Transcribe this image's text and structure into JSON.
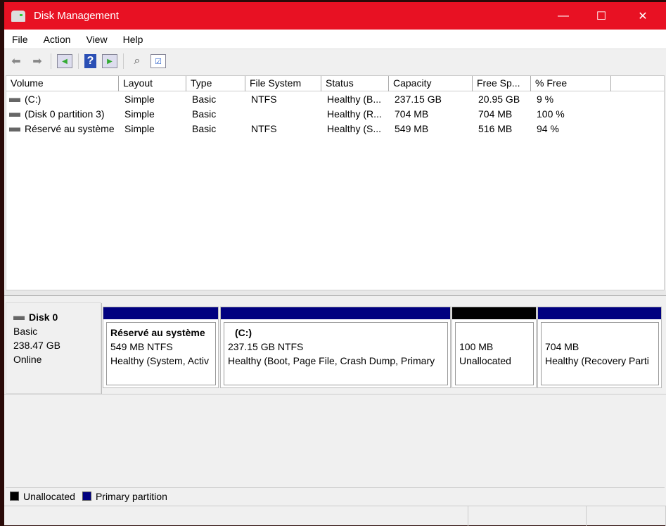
{
  "window": {
    "title": "Disk Management",
    "minimize": "—",
    "maximize": "☐",
    "close": "✕"
  },
  "menu": [
    "File",
    "Action",
    "View",
    "Help"
  ],
  "columns": [
    "Volume",
    "Layout",
    "Type",
    "File System",
    "Status",
    "Capacity",
    "Free Sp...",
    "% Free"
  ],
  "volumes": [
    [
      "(C:)",
      "Simple",
      "Basic",
      "NTFS",
      "Healthy (B...",
      "237.15 GB",
      "20.95 GB",
      "9 %"
    ],
    [
      "(Disk 0 partition 3)",
      "Simple",
      "Basic",
      "",
      "Healthy (R...",
      "704 MB",
      "704 MB",
      "100 %"
    ],
    [
      "Réservé au système",
      "Simple",
      "Basic",
      "NTFS",
      "Healthy (S...",
      "549 MB",
      "516 MB",
      "94 %"
    ]
  ],
  "disk": {
    "name": "Disk 0",
    "type": "Basic",
    "size": "238.47 GB",
    "status": "Online"
  },
  "partitions": [
    {
      "name": "Réservé au système",
      "size": "549 MB NTFS",
      "status": "Healthy (System, Activ",
      "color": "#000080"
    },
    {
      "name": "(C:)",
      "size": "237.15 GB NTFS",
      "status": "Healthy (Boot, Page File, Crash Dump, Primary",
      "color": "#000080"
    },
    {
      "name": "",
      "size": "100 MB",
      "status": "Unallocated",
      "color": "#000000"
    },
    {
      "name": "",
      "size": "704 MB",
      "status": "Healthy (Recovery Parti",
      "color": "#000080"
    }
  ],
  "legend": [
    {
      "label": "Unallocated",
      "color": "#000000"
    },
    {
      "label": "Primary partition",
      "color": "#000080"
    }
  ]
}
